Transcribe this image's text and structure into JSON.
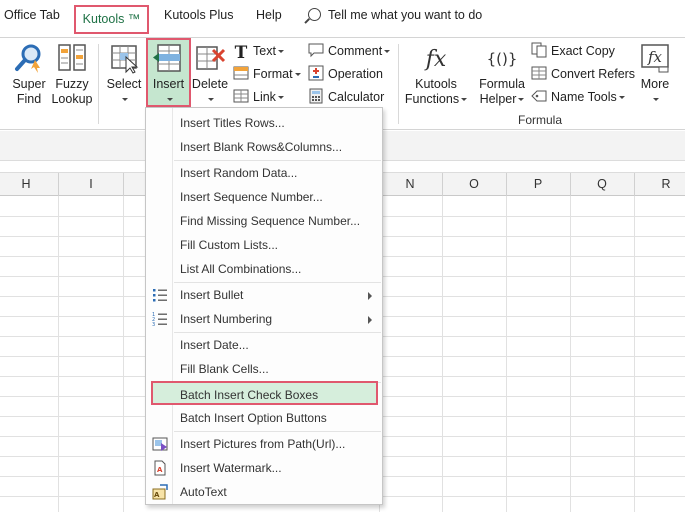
{
  "tabs": {
    "office_tab": "Office Tab",
    "kutools": "Kutools ™",
    "kutools_plus": "Kutools Plus",
    "help": "Help",
    "tell_me": "Tell me what you want to do"
  },
  "ribbon": {
    "super_find": [
      "Super",
      "Find"
    ],
    "fuzzy_lookup": [
      "Fuzzy",
      "Lookup"
    ],
    "select": "Select",
    "insert": "Insert",
    "delete": "Delete",
    "text": "Text",
    "format": "Format",
    "link": "Link",
    "comment": "Comment",
    "operation": "Operation",
    "calculator": "Calculator",
    "kutools_functions": [
      "Kutools",
      "Functions"
    ],
    "formula_helper": [
      "Formula",
      "Helper"
    ],
    "exact_copy": "Exact Copy",
    "convert_refers": "Convert Refers",
    "name_tools": "Name Tools",
    "more": "More",
    "formula_group": "Formula"
  },
  "columns": [
    "H",
    "I",
    "N",
    "O",
    "P",
    "Q",
    "R"
  ],
  "menu": {
    "items": [
      {
        "label": "Insert Titles Rows..."
      },
      {
        "label": "Insert Blank Rows&Columns..."
      },
      {
        "label": "Insert Random Data..."
      },
      {
        "label": "Insert Sequence Number..."
      },
      {
        "label": "Find Missing Sequence Number..."
      },
      {
        "label": "Fill Custom Lists..."
      },
      {
        "label": "List All Combinations..."
      },
      {
        "label": "Insert Bullet",
        "icon": "bullet-list-icon",
        "submenu": true
      },
      {
        "label": "Insert Numbering",
        "icon": "numbered-list-icon",
        "submenu": true
      },
      {
        "label": "Insert Date..."
      },
      {
        "label": "Fill Blank Cells..."
      },
      {
        "label": "Batch Insert Check Boxes",
        "highlighted": true
      },
      {
        "label": "Batch Insert Option Buttons"
      },
      {
        "label": "Insert Pictures from Path(Url)...",
        "icon": "picture-icon"
      },
      {
        "label": "Insert Watermark...",
        "icon": "watermark-icon"
      },
      {
        "label": "AutoText",
        "icon": "autotext-icon"
      }
    ]
  },
  "colors": {
    "kutools_tab_text": "#1e7145",
    "highlight_border": "#e0586e",
    "highlight_fill": "#d6eedc",
    "insert_button_fill": "#c5e6cf"
  }
}
